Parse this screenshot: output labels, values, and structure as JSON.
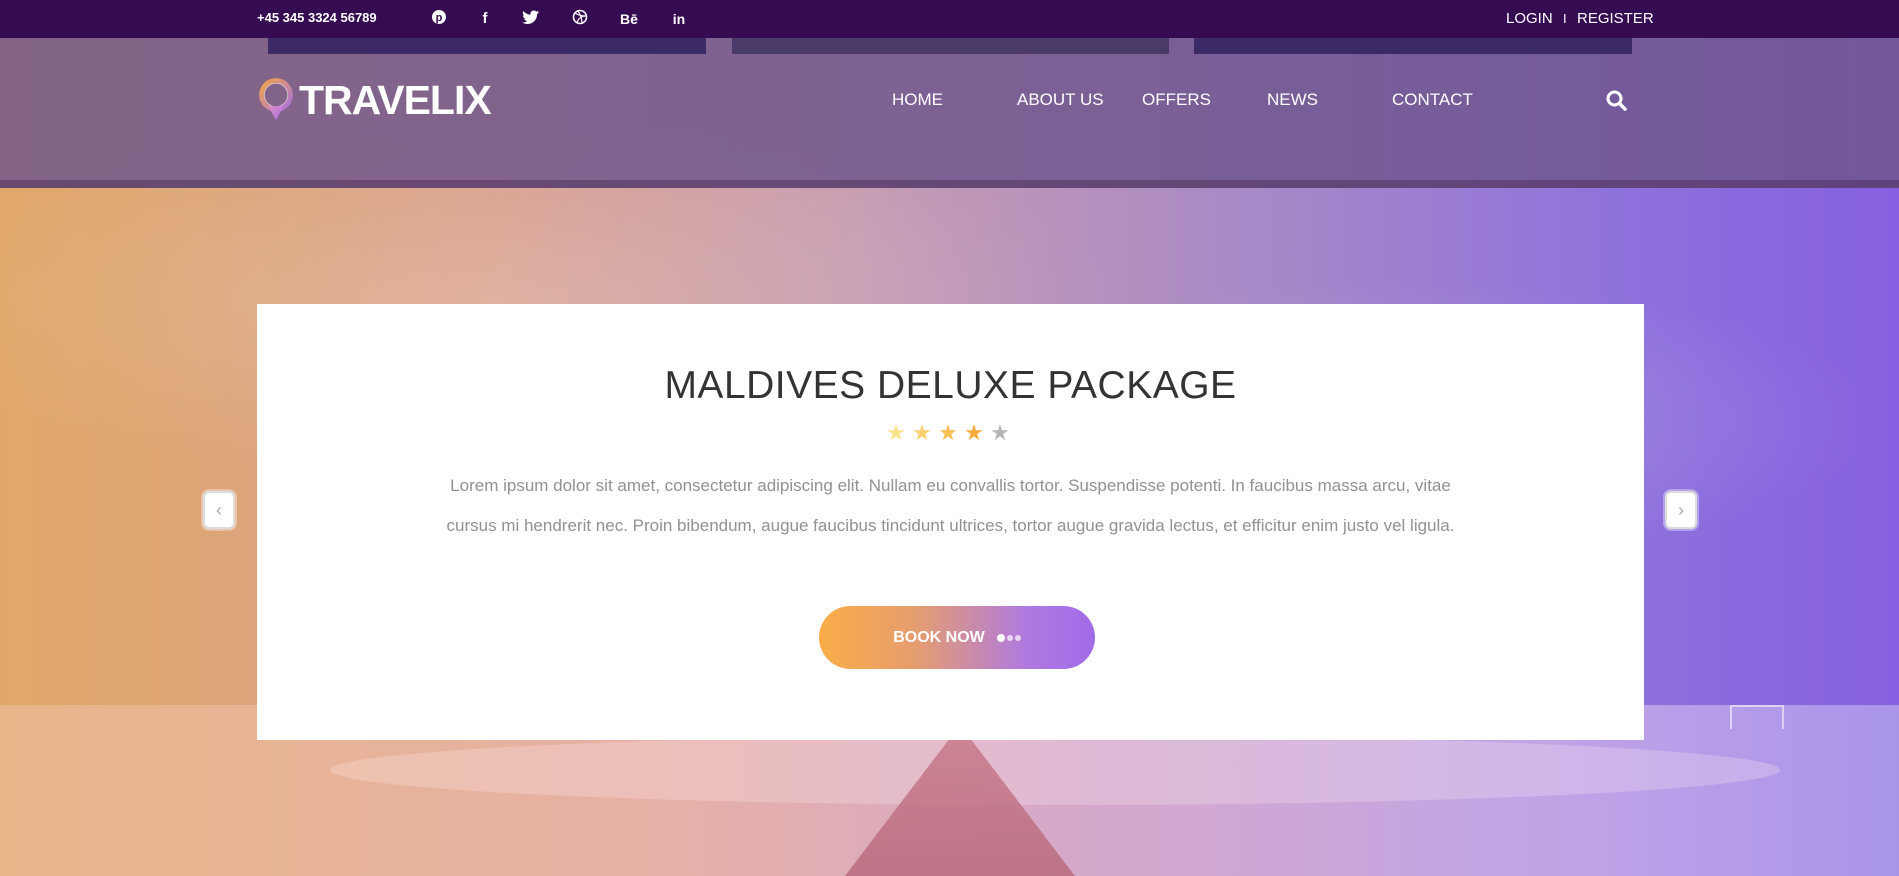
{
  "topbar": {
    "phone": "+45 345 3324 56789",
    "social": [
      {
        "icon": "pinterest-icon",
        "glyph": "℗"
      },
      {
        "icon": "facebook-icon",
        "glyph": "f"
      },
      {
        "icon": "twitter-icon",
        "glyph": "🐦"
      },
      {
        "icon": "dribbble-icon",
        "glyph": "⊛"
      },
      {
        "icon": "behance-icon",
        "glyph": "Bē"
      },
      {
        "icon": "linkedin-icon",
        "glyph": "in"
      }
    ],
    "login": "LOGIN",
    "separator": "I",
    "register": "REGISTER"
  },
  "header": {
    "logo_text": "TRAVELIX",
    "nav": [
      "HOME",
      "ABOUT US",
      "OFFERS",
      "NEWS",
      "CONTACT"
    ],
    "search_icon": "search-icon"
  },
  "hero": {
    "title": "MALDIVES DELUXE PACKAGE",
    "rating": 4,
    "rating_max": 5,
    "description_line1": "Lorem ipsum dolor sit amet, consectetur adipiscing elit. Nullam eu convallis tortor. Suspendisse potenti. In faucibus massa arcu, vitae",
    "description_line2": "cursus mi hendrerit nec. Proin bibendum, augue faucibus tincidunt ultrices, tortor augue gravida lectus, et efficitur enim justo vel ligula.",
    "book_label": "BOOK NOW",
    "prev": "‹",
    "next": "›"
  },
  "colors": {
    "topbar": "#350c51",
    "gradient_start": "#fbad47",
    "gradient_end": "#a26be9",
    "title": "#333333",
    "description": "#929193"
  }
}
